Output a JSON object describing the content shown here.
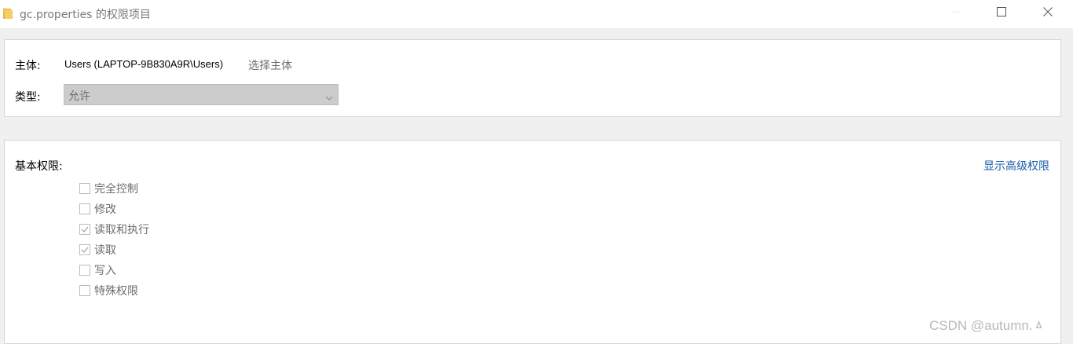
{
  "window": {
    "title": "gc.properties 的权限项目",
    "icon": "folder-icon",
    "controls": {
      "minimize": "minimize-icon",
      "maximize": "maximize-icon",
      "close": "close-icon"
    }
  },
  "principal": {
    "label": "主体:",
    "value": "Users (LAPTOP-9B830A9R\\Users)",
    "select_link": "选择主体"
  },
  "type": {
    "label": "类型:",
    "selected": "允许"
  },
  "permissions": {
    "heading": "基本权限:",
    "show_advanced": "显示高级权限",
    "items": [
      {
        "label": "完全控制",
        "checked": false
      },
      {
        "label": "修改",
        "checked": false
      },
      {
        "label": "读取和执行",
        "checked": true
      },
      {
        "label": "读取",
        "checked": true
      },
      {
        "label": "写入",
        "checked": false
      },
      {
        "label": "特殊权限",
        "checked": false
      }
    ]
  },
  "watermark": "CSDN @autumn.ㅿ",
  "colors": {
    "link": "#1a5ea6",
    "disabled_text": "#6d6d6d",
    "dropdown_bg": "#cccccc",
    "window_bg": "#f0f0f0"
  }
}
